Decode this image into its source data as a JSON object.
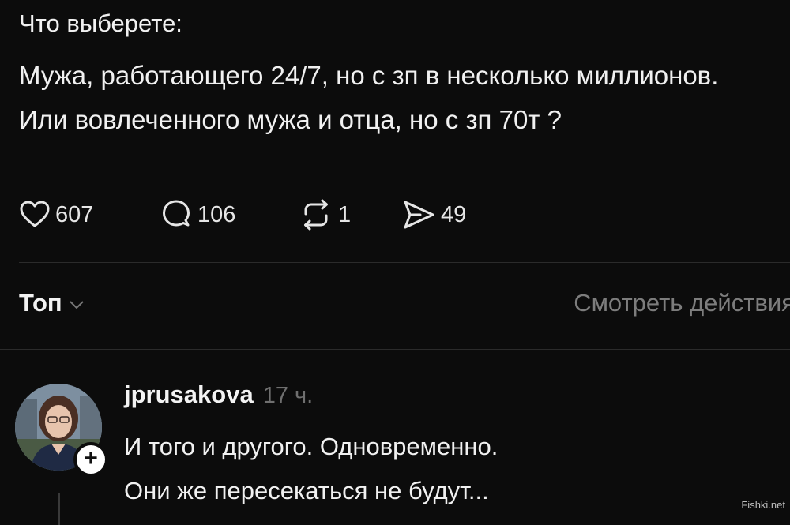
{
  "post": {
    "intro": "Что выберете:",
    "body": "Мужа, работающего 24/7, но с зп в несколько миллионов. Или вовлеченного мужа и отца, но с зп 70т ?"
  },
  "actions": {
    "likes": "607",
    "replies": "106",
    "reposts": "1",
    "shares": "49"
  },
  "sort": {
    "label": "Топ"
  },
  "view_activity": "Смотреть действия",
  "comment": {
    "username": "jprusakova",
    "time": "17 ч.",
    "line1": "И того и другого. Одновременно.",
    "line2": "Они же пересекаться не будут...",
    "follow_symbol": "+"
  },
  "watermark": "Fishki.net"
}
